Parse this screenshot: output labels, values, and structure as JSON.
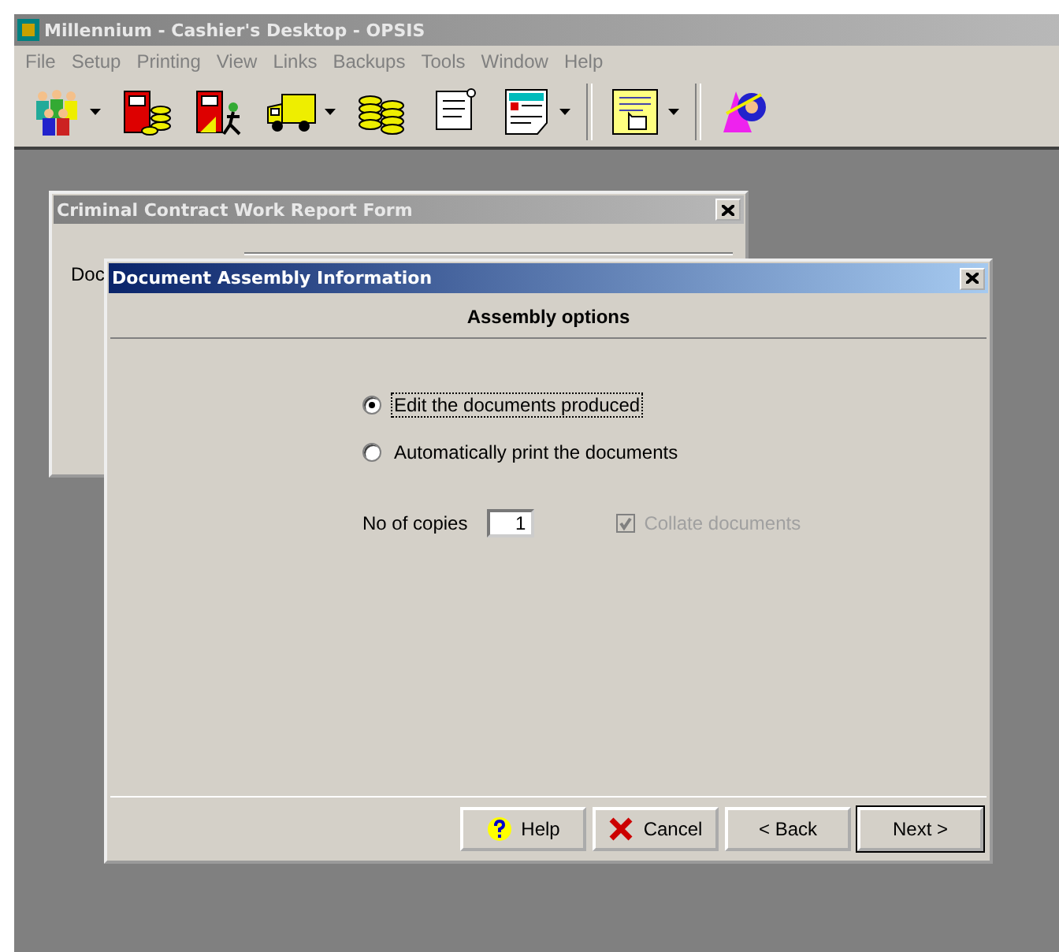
{
  "window": {
    "title": "Millennium - Cashier's Desktop - OPSIS",
    "active": false
  },
  "menu": [
    "File",
    "Setup",
    "Printing",
    "View",
    "Links",
    "Backups",
    "Tools",
    "Window",
    "Help"
  ],
  "toolbar": [
    {
      "kind": "button",
      "dropdown": true
    },
    {
      "kind": "button",
      "dropdown": false
    },
    {
      "kind": "button",
      "dropdown": false
    },
    {
      "kind": "button",
      "dropdown": true
    },
    {
      "kind": "button",
      "dropdown": false
    },
    {
      "kind": "button",
      "dropdown": false
    },
    {
      "kind": "button",
      "dropdown": true
    },
    {
      "kind": "separator"
    },
    {
      "kind": "button",
      "dropdown": true
    },
    {
      "kind": "separator"
    },
    {
      "kind": "button",
      "dropdown": false
    }
  ],
  "background_window": {
    "title": "Criminal Contract Work Report Form",
    "label": "Doc"
  },
  "dialog": {
    "title": "Document Assembly Information",
    "heading": "Assembly options",
    "options": [
      {
        "label": "Edit the documents produced",
        "selected": true,
        "focused": true
      },
      {
        "label": "Automatically print the documents",
        "selected": false,
        "focused": false
      }
    ],
    "copies": {
      "label": "No of copies",
      "value": "1"
    },
    "collate": {
      "label": "Collate documents",
      "checked": true,
      "disabled": true
    },
    "buttons": [
      {
        "kind": "help",
        "label": "Help",
        "default": false
      },
      {
        "kind": "cancel",
        "label": "Cancel",
        "default": false
      },
      {
        "kind": "plain",
        "label": "< Back",
        "default": false
      },
      {
        "kind": "plain",
        "label": "Next >",
        "default": true
      }
    ]
  }
}
